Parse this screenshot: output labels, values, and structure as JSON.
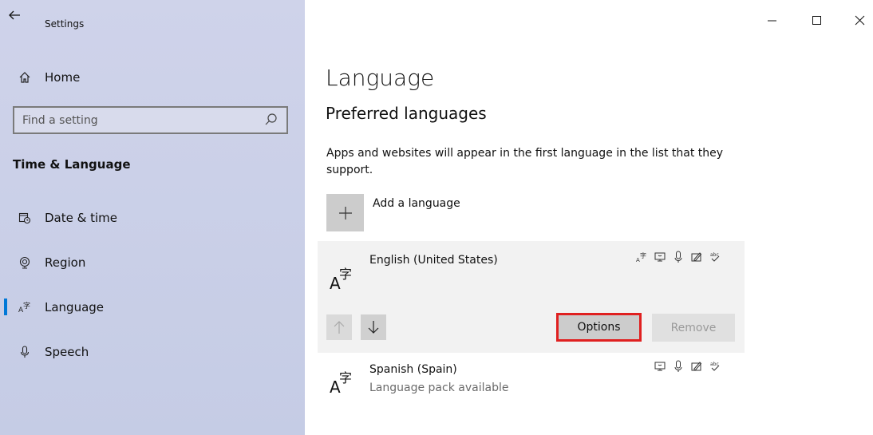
{
  "window": {
    "title": "Settings"
  },
  "sidebar": {
    "home_label": "Home",
    "search_placeholder": "Find a setting",
    "section_heading": "Time & Language",
    "items": [
      {
        "label": "Date & time",
        "icon": "calendar-clock-icon",
        "active": false
      },
      {
        "label": "Region",
        "icon": "globe-icon",
        "active": false
      },
      {
        "label": "Language",
        "icon": "language-icon",
        "active": true
      },
      {
        "label": "Speech",
        "icon": "microphone-icon",
        "active": false
      }
    ]
  },
  "main": {
    "page_title": "Language",
    "subtitle": "Preferred languages",
    "description": "Apps and websites will appear in the first language in the list that they support.",
    "add_language_label": "Add a language",
    "languages": [
      {
        "name": "English (United States)",
        "sub": "",
        "features": [
          "display-language-icon",
          "text-to-speech-icon",
          "speech-recognition-icon",
          "handwriting-icon",
          "spell-check-icon"
        ]
      },
      {
        "name": "Spanish (Spain)",
        "sub": "Language pack available",
        "features": [
          "text-to-speech-icon",
          "speech-recognition-icon",
          "handwriting-icon",
          "spell-check-icon"
        ]
      }
    ],
    "buttons": {
      "options": "Options",
      "remove": "Remove"
    }
  },
  "colors": {
    "accent": "#0078d7",
    "highlight": "#e02020",
    "sidebar_bg": "#c9cfe6"
  }
}
